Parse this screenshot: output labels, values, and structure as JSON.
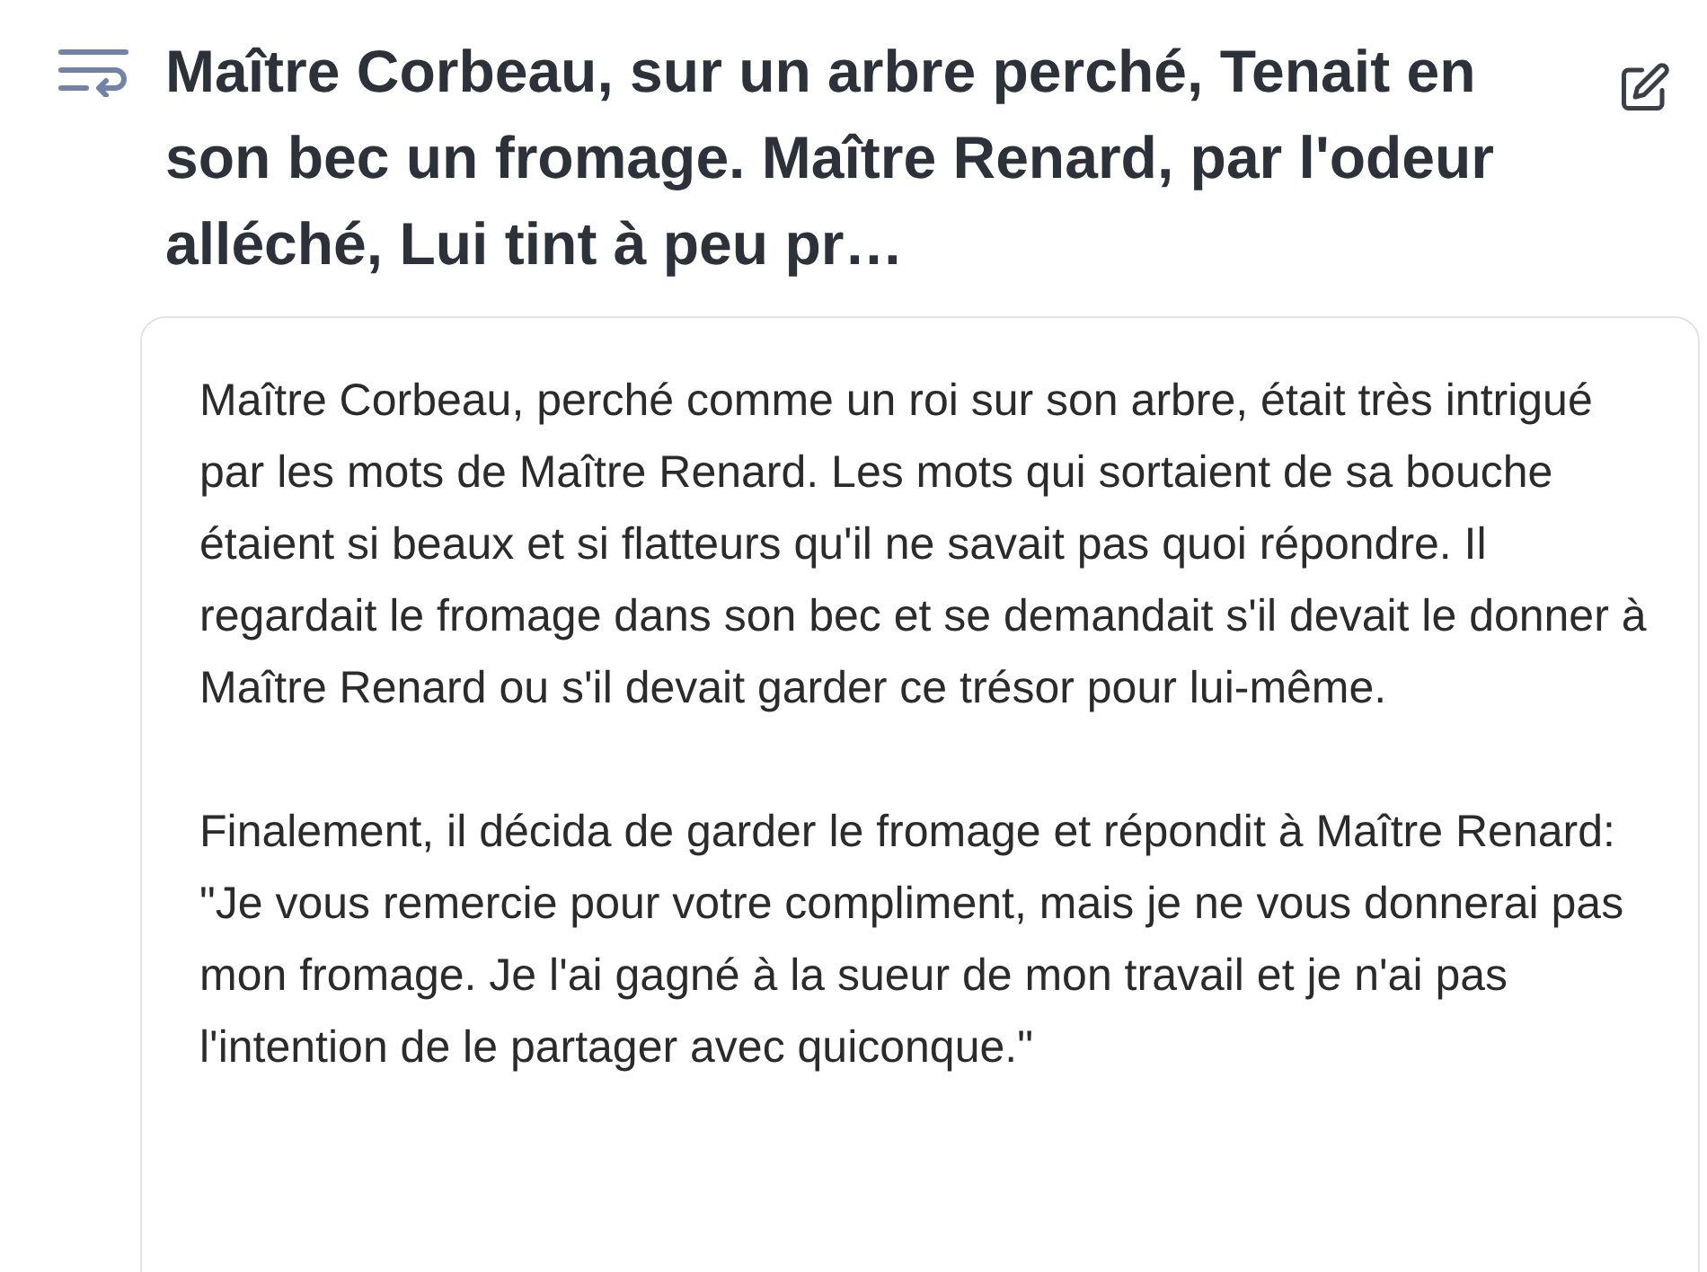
{
  "title": "Maître Corbeau, sur un arbre perché, Tenait en son bec un fromage. Maître Renard, par l'odeur alléché, Lui tint à peu pr…",
  "paragraphs": [
    "Maître Corbeau, perché comme un roi sur son arbre, était très intrigué par les mots de Maître Renard. Les mots qui sortaient de sa bouche étaient si beaux et si flatteurs qu'il ne savait pas quoi répondre. Il regardait le fromage dans son bec et se demandait s'il devait le donner à Maître Renard ou s'il devait garder ce trésor pour lui-même.",
    "Finalement, il décida de garder le fromage et répondit à Maître Renard: \"Je vous remercie pour votre compliment, mais je ne vous donnerai pas mon fromage. Je l'ai gagné à la sueur de mon travail et je n'ai pas l'intention de le partager avec quiconque.\""
  ]
}
